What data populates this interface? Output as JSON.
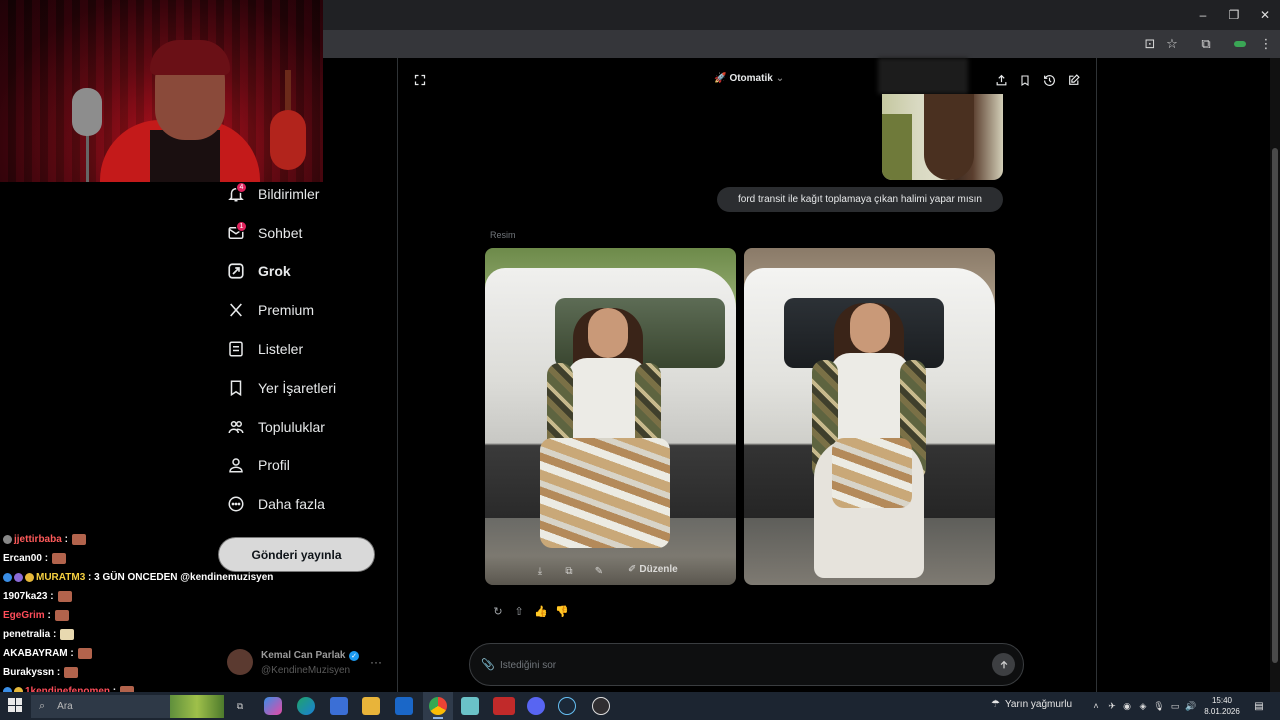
{
  "browser": {
    "window_controls": {
      "minimize": "–",
      "restore": "❐",
      "close": "✕"
    }
  },
  "sidebar": {
    "items": [
      {
        "label": "Bildirimler",
        "icon": "bell-icon",
        "badge": "4"
      },
      {
        "label": "Sohbet",
        "icon": "mail-icon",
        "badge": "1"
      },
      {
        "label": "Grok",
        "icon": "grok-icon",
        "active": true
      },
      {
        "label": "Premium",
        "icon": "x-logo-icon"
      },
      {
        "label": "Listeler",
        "icon": "list-icon"
      },
      {
        "label": "Yer İşaretleri",
        "icon": "bookmark-icon"
      },
      {
        "label": "Topluluklar",
        "icon": "communities-icon"
      },
      {
        "label": "Profil",
        "icon": "profile-icon"
      },
      {
        "label": "Daha fazla",
        "icon": "more-circle-icon"
      }
    ],
    "post_button": "Gönderi yayınla",
    "account": {
      "name": "Kemal Can Parlak",
      "handle": "@KendineMuzisyen",
      "verified_mark": "✓",
      "more": "···"
    }
  },
  "chat": [
    {
      "user": "jjettirbaba",
      "message": "",
      "color": "#ff5a5a",
      "emote": "brick"
    },
    {
      "user": "Ercan00",
      "message": "",
      "color": "#ffffff",
      "emote": "brick"
    },
    {
      "user": "MURATM3",
      "message": "3 GÜN ONCEDEN @kendinemuzisyen",
      "color": "#f5d040",
      "emote": ""
    },
    {
      "user": "1907ka23",
      "message": "",
      "color": "#ffffff",
      "emote": "brick"
    },
    {
      "user": "EgeGrim",
      "message": "",
      "color": "#ff4d5a",
      "emote": "brick"
    },
    {
      "user": "penetralia",
      "message": "",
      "color": "#ffffff",
      "emote": "light"
    },
    {
      "user": "AKABAYRAM",
      "message": "",
      "color": "#ffffff",
      "emote": "brick"
    },
    {
      "user": "Burakyssn",
      "message": "",
      "color": "#ffffff",
      "emote": "brick"
    },
    {
      "user": "1kendinefenomen",
      "message": "",
      "color": "#ff4d5a",
      "emote": "brick"
    }
  ],
  "grok": {
    "mode_label": "Otomatik",
    "mode_icon": "rocket-icon",
    "user_message": "ford transit ile kağıt toplamaya çıkan halimi yapar mısın",
    "result_label": "Resim",
    "edit_label": "Düzenle",
    "composer_placeholder": "İstediğini sor"
  },
  "taskbar": {
    "search_placeholder": "Ara",
    "weather": "Yarın yağmurlu",
    "time": "15:40",
    "date": "8.01.2026",
    "apps": [
      "task-view-icon",
      "copilot-icon",
      "edge-icon",
      "store-icon",
      "file-explorer-icon",
      "outlook-icon",
      "chrome-icon",
      "notepad-icon",
      "voice-meter-icon",
      "discord-icon",
      "steam-icon",
      "obs-icon"
    ]
  },
  "colors": {
    "background": "#000000",
    "text": "#e7e9ea",
    "muted": "#71767b",
    "badge": "#e0245e",
    "verified": "#1d9bf0"
  }
}
